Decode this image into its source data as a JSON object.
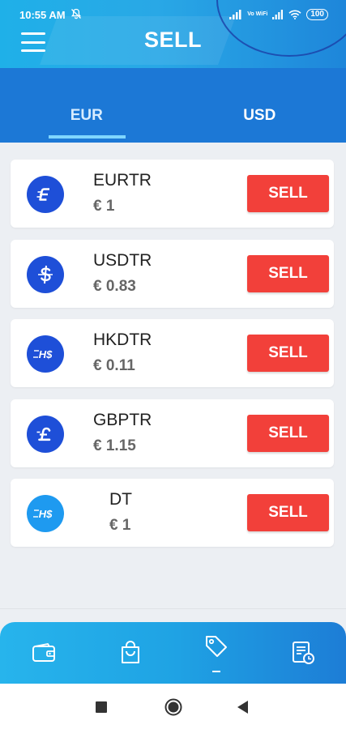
{
  "status_bar": {
    "time": "10:55 AM",
    "network_label": "Vo WiFi",
    "battery": "100",
    "icons": [
      "notifications-off-icon",
      "signal-icon",
      "signal-icon",
      "wifi-icon",
      "battery-icon"
    ]
  },
  "header": {
    "title": "SELL",
    "menu_icon": "hamburger-menu-icon"
  },
  "tabs": [
    {
      "label": "EUR",
      "active": true
    },
    {
      "label": "USD",
      "active": false
    }
  ],
  "assets": [
    {
      "name": "EURTR",
      "price": "€ 1",
      "icon": "euro-token-icon",
      "icon_color": "#1e4fd8",
      "action": "SELL"
    },
    {
      "name": "USDTR",
      "price": "€ 0.83",
      "icon": "dollar-token-icon",
      "icon_color": "#1e4fd8",
      "action": "SELL"
    },
    {
      "name": "HKDTR",
      "price": "€ 0.11",
      "icon": "hkd-token-icon",
      "icon_color": "#1e4fd8",
      "action": "SELL"
    },
    {
      "name": "GBPTR",
      "price": "€ 1.15",
      "icon": "pound-token-icon",
      "icon_color": "#1e4fd8",
      "action": "SELL"
    },
    {
      "name": "DT",
      "price": "€ 1",
      "icon": "hkd-token-icon",
      "icon_color": "#1e9af0",
      "action": "SELL"
    }
  ],
  "bottom_nav": [
    {
      "icon": "wallet-icon",
      "active": false
    },
    {
      "icon": "shopping-bag-icon",
      "active": false
    },
    {
      "icon": "price-tag-icon",
      "active": true
    },
    {
      "icon": "transaction-history-icon",
      "active": false
    }
  ],
  "system_nav": [
    "recent-apps-icon",
    "home-icon",
    "back-icon"
  ],
  "colors": {
    "sell_button": "#f2403a",
    "tab_bar": "#1c78d6",
    "tab_indicator": "#7fd6ff",
    "background": "#eceff3"
  }
}
